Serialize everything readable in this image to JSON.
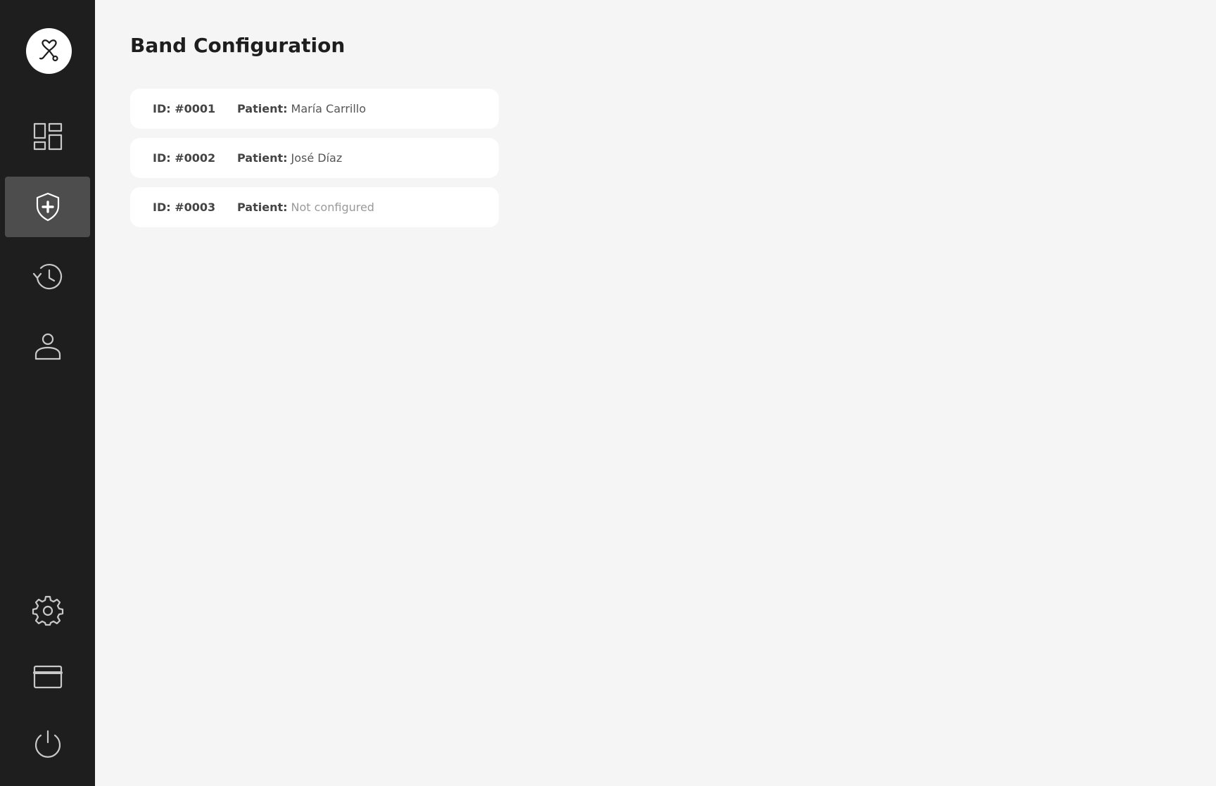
{
  "page": {
    "title": "Band Configuration"
  },
  "sidebar": {
    "logo_icon": "heart-stethoscope-icon",
    "items": [
      {
        "id": "dashboard",
        "icon": "dashboard-icon",
        "active": false
      },
      {
        "id": "bands",
        "icon": "shield-plus-icon",
        "active": true
      },
      {
        "id": "history",
        "icon": "history-icon",
        "active": false
      },
      {
        "id": "profile",
        "icon": "user-icon",
        "active": false
      },
      {
        "id": "settings",
        "icon": "gear-icon",
        "active": false
      },
      {
        "id": "billing",
        "icon": "credit-card-icon",
        "active": false
      },
      {
        "id": "logout",
        "icon": "power-icon",
        "active": false
      }
    ]
  },
  "bands": [
    {
      "id_label": "ID: #0001",
      "patient_label": "Patient:",
      "patient_value": "María Carrillo",
      "configured": true
    },
    {
      "id_label": "ID: #0002",
      "patient_label": "Patient:",
      "patient_value": "José Díaz",
      "configured": true
    },
    {
      "id_label": "ID: #0003",
      "patient_label": "Patient:",
      "patient_value": "Not configured",
      "configured": false
    }
  ],
  "colors": {
    "sidebar_bg": "#1e1e1e",
    "active_item_bg": "#4d4d4d",
    "page_bg": "#f5f5f5",
    "card_bg": "#ffffff",
    "muted_text": "#9a9a9a"
  }
}
